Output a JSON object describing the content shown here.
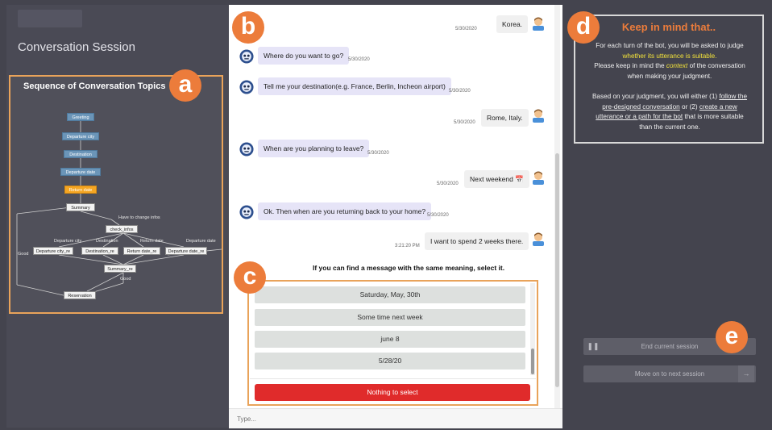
{
  "left_panel": {
    "session_title": "Conversation Session",
    "topics_title": "Sequence of Conversation Topics",
    "flow": {
      "nodes": {
        "greeting": "Greeting",
        "departure_city": "Departure city",
        "destination": "Destination",
        "departure_date": "Departure date",
        "return_date": "Return date",
        "summary": "Summary",
        "check_infos": "check_infos",
        "departure_city_re": "Departure city_re",
        "destination_re": "Destination_re",
        "return_date_re": "Return date_re",
        "departure_date_re": "Departure date_re",
        "summary_re": "Summary_re",
        "reservation": "Reservation"
      },
      "edges": {
        "have_to_change": "Have to change infos",
        "departure_city": "Departure city",
        "destination": "Destination",
        "return_date": "Return date",
        "departure_date": "Departure date",
        "good_left": "Good",
        "good_bottom": "Good"
      }
    }
  },
  "badges": {
    "a": "a",
    "b": "b",
    "c": "c",
    "d": "d",
    "e": "e"
  },
  "chat": {
    "messages": [
      {
        "from": "user",
        "text": "Korea.",
        "time": "5/30/2020"
      },
      {
        "from": "bot",
        "text": "Where do you want to go?",
        "time": "5/30/2020"
      },
      {
        "from": "bot",
        "text": "Tell me your destination(e.g. France, Berlin, Incheon airport)",
        "time": "5/30/2020"
      },
      {
        "from": "user",
        "text": "Rome, Italy.",
        "time": "5/30/2020"
      },
      {
        "from": "bot",
        "text": "When are you planning to leave?",
        "time": "5/30/2020"
      },
      {
        "from": "user",
        "text": "Next weekend 📅",
        "time": "5/30/2020"
      },
      {
        "from": "bot",
        "text": "Ok. Then when are you returning back to your home?",
        "time": "5/30/2020"
      },
      {
        "from": "user",
        "text": "I want to spend 2 weeks there.",
        "time": "3:21:20 PM"
      }
    ],
    "find_label": "If you can find a message with the same meaning, select it.",
    "options": [
      "Saturday, May, 30th",
      "Some time next week",
      "june 8",
      "5/28/20"
    ],
    "nothing_button": "Nothing to select",
    "input_placeholder": "Type..."
  },
  "right_panel": {
    "keep_title": "Keep in mind that..",
    "p1_a": "For each turn of the bot, you will be asked to judge",
    "p1_b": "whether its utterance is suitable.",
    "p1_c": "Please keep in mind the",
    "p1_d": "context",
    "p1_e": "of the conversation",
    "p1_f": "when making your judgment.",
    "p2_a": "Based on your judgment, you will either (1)",
    "p2_b": "follow the",
    "p2_c": "pre-designed conversation",
    "p2_d": "or (2)",
    "p2_e": "create a new",
    "p2_f": "utterance or a path for the bot",
    "p2_g": "that is more suitable",
    "p2_h": "than the current one.",
    "end_session": "End current session",
    "next_session": "Move on to next session"
  },
  "colors": {
    "accent": "#ec7c3b",
    "bot_bubble": "#e6e4f7",
    "danger": "#e02b2b",
    "highlight": "#f2e23a"
  }
}
